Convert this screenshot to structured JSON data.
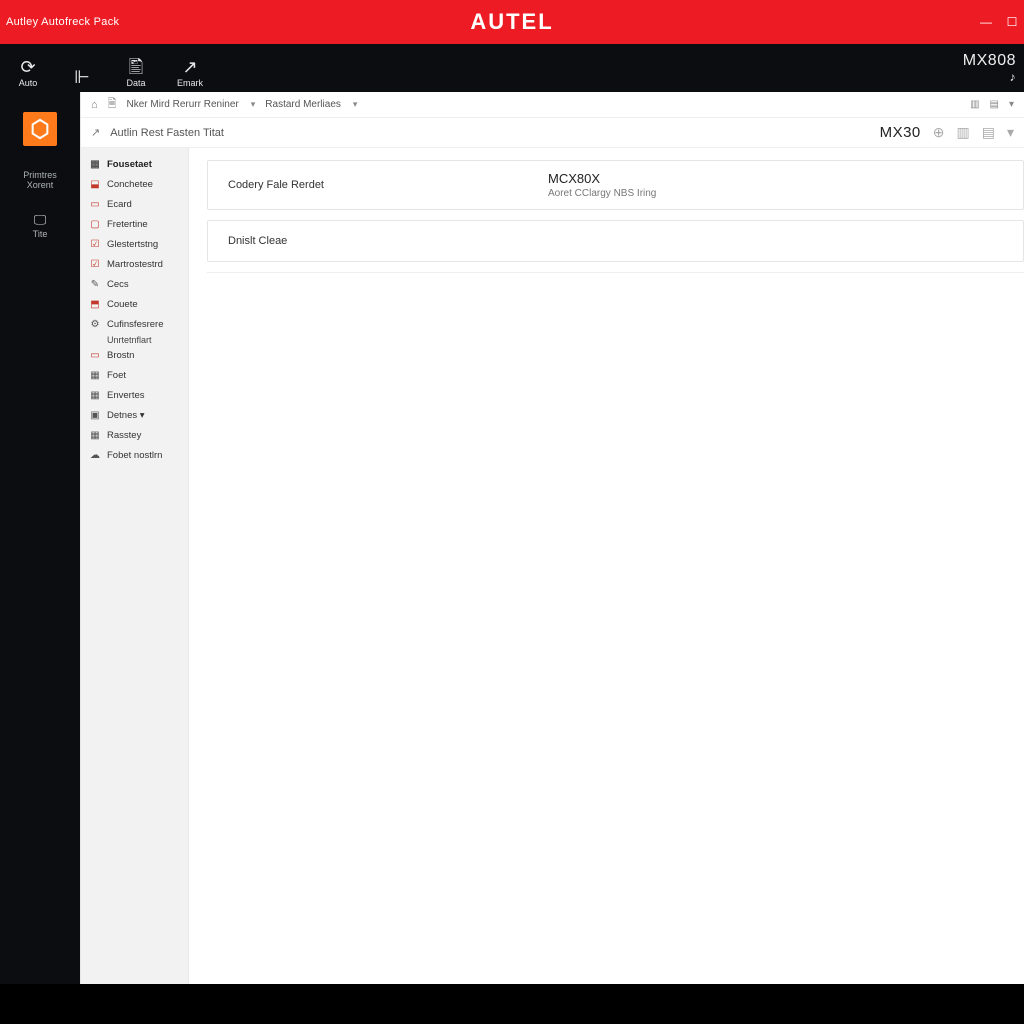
{
  "titlebar": {
    "left": "Autley Autofreck Pack",
    "brand": "AUTEL"
  },
  "blackbar": {
    "tools": [
      {
        "icon": "⟳",
        "label": "Auto"
      },
      {
        "icon": "⊩",
        "label": ""
      },
      {
        "icon": "🖺",
        "label": "Data"
      },
      {
        "icon": "↗",
        "label": "Emark"
      }
    ],
    "model": "MX808",
    "model_sub": "♪"
  },
  "crumbs1": {
    "items": [
      "Nker Mird Rerurr Reniner",
      "Rastard  Merliaes"
    ],
    "right_icons": [
      "▥",
      "▤",
      "▾"
    ]
  },
  "crumbs2": {
    "label": "Autlin Rest Fasten Titat",
    "mx": "MX30",
    "right_icons": [
      "⊕",
      "▥",
      "▤",
      "▾"
    ]
  },
  "rail": {
    "items": [
      {
        "label": "Primtres Xorent"
      },
      {
        "label": "Tite"
      }
    ]
  },
  "sidebar": {
    "items": [
      {
        "icon": "▦",
        "label": "Fousetaet",
        "cls": "g"
      },
      {
        "icon": "⬓",
        "label": "Conchetee",
        "cls": ""
      },
      {
        "icon": "▭",
        "label": "Ecard",
        "cls": ""
      },
      {
        "icon": "▢",
        "label": "Fretertine",
        "cls": ""
      },
      {
        "icon": "☑",
        "label": "Glestertstng",
        "cls": ""
      },
      {
        "icon": "☑",
        "label": "Martrostestrd",
        "cls": ""
      },
      {
        "icon": "✎",
        "label": "Cecs",
        "cls": "g"
      },
      {
        "icon": "⬒",
        "label": "Couete",
        "cls": ""
      },
      {
        "icon": "⚙",
        "label": "Cufinsfesrere",
        "cls": "g",
        "sub": "Unrtetnflart"
      },
      {
        "icon": "▭",
        "label": "Brostn",
        "cls": ""
      },
      {
        "icon": "▦",
        "label": "Foet",
        "cls": "g"
      },
      {
        "icon": "▦",
        "label": "Envertes",
        "cls": "g"
      },
      {
        "icon": "▣",
        "label": "Detnes  ▾",
        "cls": "g"
      },
      {
        "icon": "▦",
        "label": "Rasstey",
        "cls": "g"
      },
      {
        "icon": "☁",
        "label": "Fobet nostlrn",
        "cls": "g"
      }
    ]
  },
  "cards": [
    {
      "left": "Codery Fale Rerdet",
      "title": "MCX80X",
      "subtitle": "Aoret CClargy NBS Iring"
    },
    {
      "left": "Dnislt Cleae",
      "title": "",
      "subtitle": ""
    }
  ]
}
